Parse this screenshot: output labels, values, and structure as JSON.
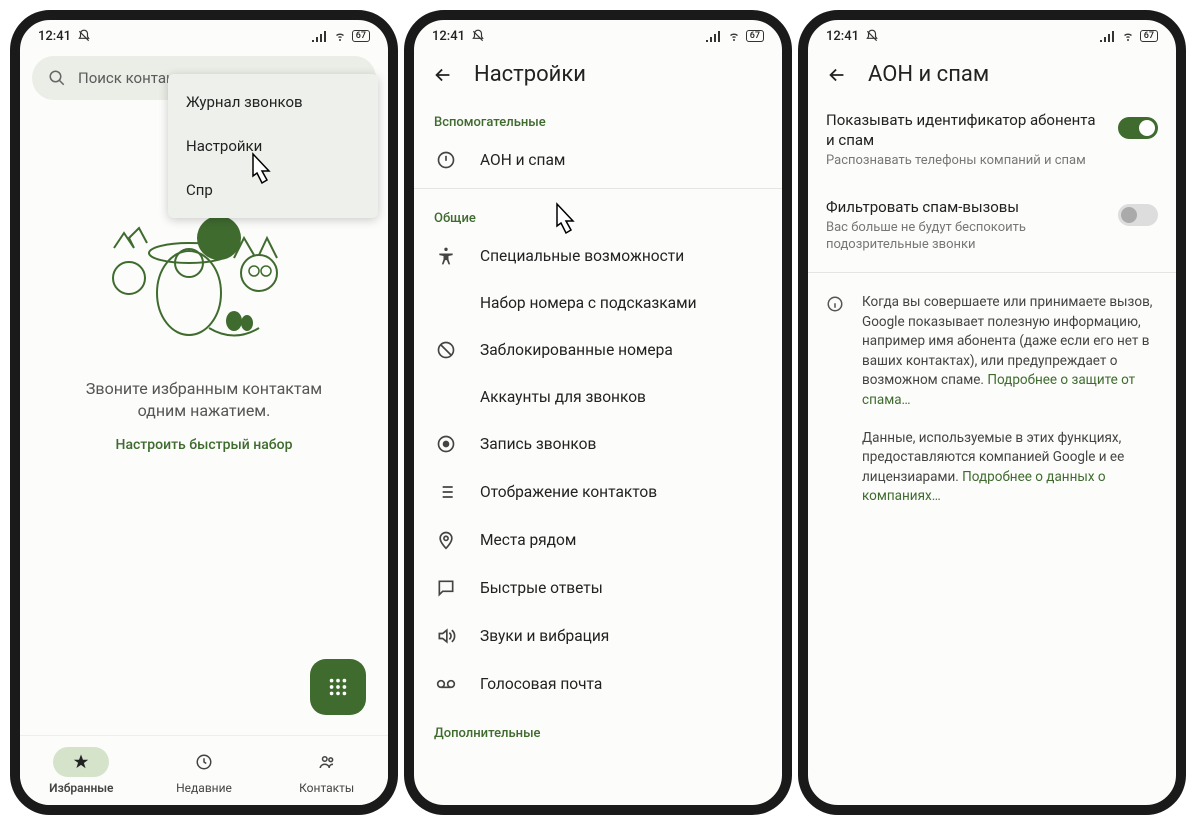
{
  "status": {
    "time": "12:41",
    "battery": "67"
  },
  "phone1": {
    "search_placeholder": "Поиск контакто",
    "menu": {
      "item1": "Журнал звонков",
      "item2": "Настройки",
      "item3": "Спр"
    },
    "empty_text": "Звоните избранным контактам одним нажатием.",
    "setup_link": "Настроить быстрый набор",
    "nav": {
      "fav": "Избранные",
      "recent": "Недавние",
      "contacts": "Контакты"
    }
  },
  "phone2": {
    "title": "Настройки",
    "section1": "Вспомогательные",
    "row_caller": "АОН и спам",
    "section2": "Общие",
    "row_access": "Специальные возможности",
    "row_assisted": "Набор номера с подсказками",
    "row_blocked": "Заблокированные номера",
    "row_accounts": "Аккаунты для звонков",
    "row_record": "Запись звонков",
    "row_display": "Отображение контактов",
    "row_nearby": "Места рядом",
    "row_quick": "Быстрые ответы",
    "row_sounds": "Звуки и вибрация",
    "row_voicemail": "Голосовая почта",
    "section3": "Дополнительные"
  },
  "phone3": {
    "title": "АОН и спам",
    "toggle1_title": "Показывать идентификатор абонента и спам",
    "toggle1_sub": "Распознавать телефоны компаний и спам",
    "toggle2_title": "Фильтровать спам-вызовы",
    "toggle2_sub": "Вас больше не будут беспокоить подозрительные звонки",
    "info1": "Когда вы совершаете или принимаете вызов, Google показывает полезную информацию, например имя абонента (даже если его нет в ваших контактах), или предупреждает о возможном спаме. ",
    "info1_link": "Подробнее о защите от спама…",
    "info2": "Данные, используемые в этих функциях, предоставляются компанией Google и ее лицензиарами. ",
    "info2_link": "Подробнее о данных о компаниях…"
  }
}
